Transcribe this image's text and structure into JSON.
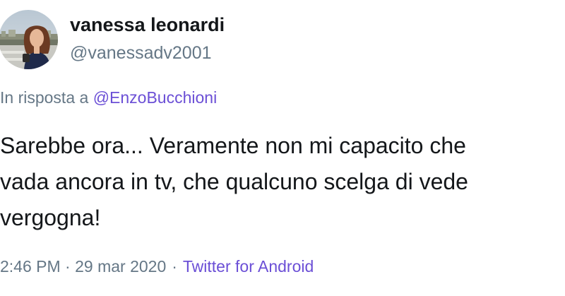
{
  "tweet": {
    "author": {
      "display_name": "vanessa leonardi",
      "handle": "@vanessadv2001",
      "avatar_icon": "profile-photo-avatar"
    },
    "reply": {
      "prefix": "In risposta a",
      "mention": "@EnzoBucchioni"
    },
    "text_lines": [
      "Sarebbe ora... Veramente non mi capacito che",
      "vada ancora in tv, che qualcuno scelga di vede",
      "vergogna!"
    ],
    "meta": {
      "time_date": "2:46 PM · 29 mar 2020",
      "separator": "·",
      "source": "Twitter for Android"
    }
  },
  "colors": {
    "text": "#14171a",
    "secondary": "#657786",
    "link": "#6b4fd6",
    "background": "#ffffff"
  }
}
